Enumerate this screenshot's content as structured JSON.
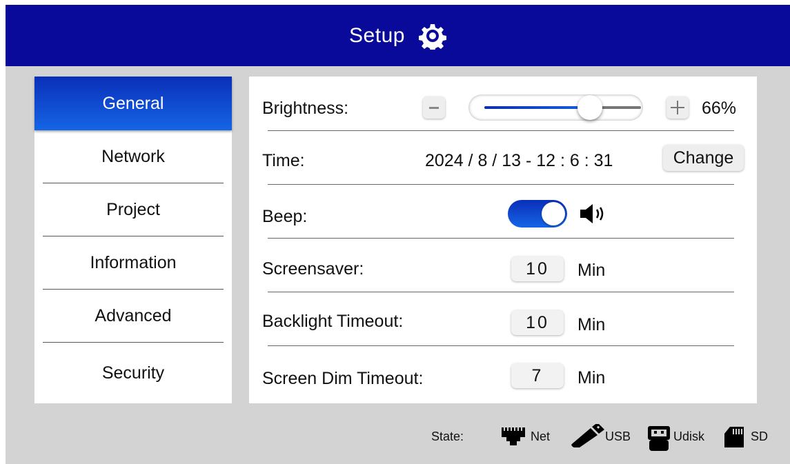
{
  "header": {
    "title": "Setup",
    "icon": "gear-icon"
  },
  "sidebar": {
    "items": [
      {
        "label": "General",
        "active": true
      },
      {
        "label": "Network",
        "active": false
      },
      {
        "label": "Project",
        "active": false
      },
      {
        "label": "Information",
        "active": false
      },
      {
        "label": "Advanced",
        "active": false
      },
      {
        "label": "Security",
        "active": false
      }
    ]
  },
  "settings": {
    "brightness": {
      "label": "Brightness:",
      "value": 0.66,
      "value_text": "66%",
      "minus_icon": "minus-icon",
      "plus_icon": "plus-icon"
    },
    "time": {
      "label": "Time:",
      "value": "2024 / 8 / 13 - 12 : 6 : 31",
      "button_label": "Change"
    },
    "beep": {
      "label": "Beep:",
      "enabled": true,
      "icon": "speaker-icon"
    },
    "screensaver": {
      "label": "Screensaver:",
      "value": "10",
      "unit": "Min"
    },
    "backlight_timeout": {
      "label": "Backlight Timeout:",
      "value": "10",
      "unit": "Min"
    },
    "screen_dim_timeout": {
      "label": "Screen Dim Timeout:",
      "value": "7",
      "unit": "Min"
    }
  },
  "status": {
    "label": "State:",
    "items": [
      {
        "label": "Net",
        "icon": "ethernet-icon"
      },
      {
        "label": "USB",
        "icon": "usb-stick-icon"
      },
      {
        "label": "Udisk",
        "icon": "udisk-icon"
      },
      {
        "label": "SD",
        "icon": "sd-card-icon"
      }
    ]
  },
  "colors": {
    "header_bg": "#0a0a9a",
    "accent": "#1565e6",
    "frame_bg": "#d3d3d3"
  }
}
